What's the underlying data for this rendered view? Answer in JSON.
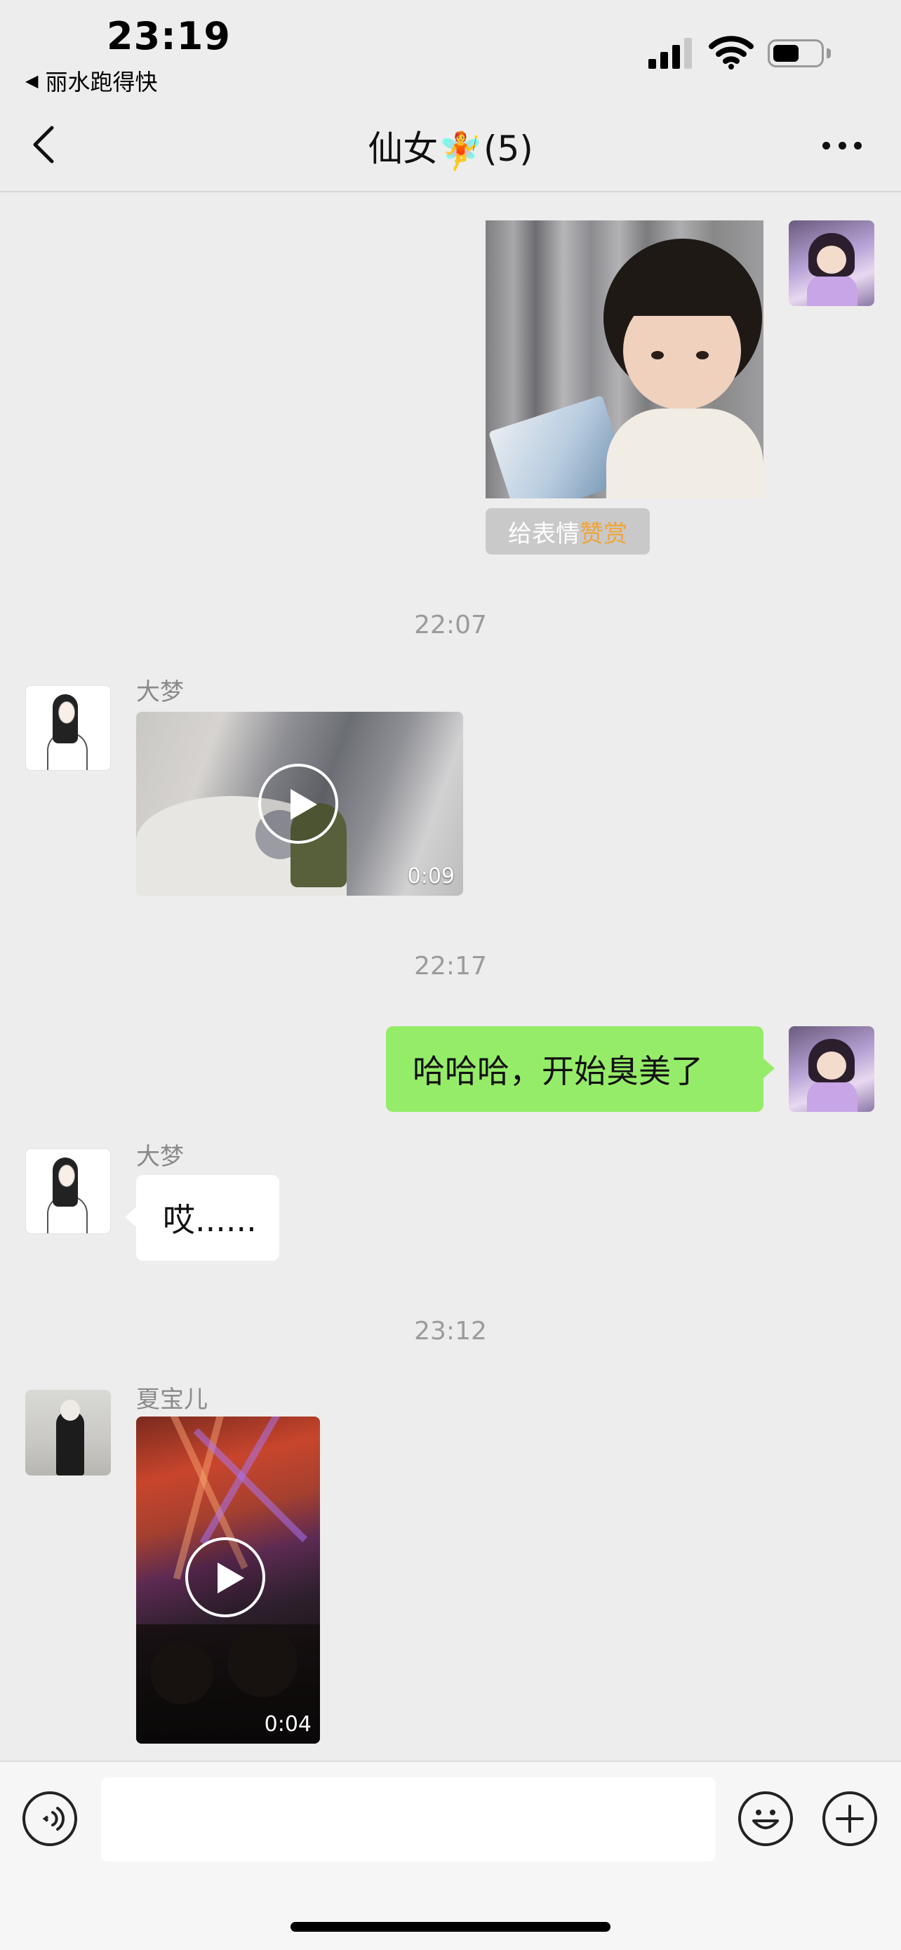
{
  "status_bar": {
    "time": "23:19",
    "back_app": "丽水跑得快",
    "back_app_icon": "left-triangle-icon"
  },
  "header": {
    "title": "仙女",
    "title_emoji": "🧚",
    "member_count": "(5)",
    "back_icon": "chevron-left-icon",
    "more_icon": "more-dots-icon"
  },
  "messages": [
    {
      "type": "sticker",
      "from": "me",
      "reward_prefix": "给表情",
      "reward_highlight": "赞赏"
    },
    {
      "type": "timestamp",
      "text": "22:07"
    },
    {
      "type": "video",
      "from": "大梦",
      "duration": "0:09"
    },
    {
      "type": "timestamp",
      "text": "22:17"
    },
    {
      "type": "text",
      "from": "me",
      "text": "哈哈哈，开始臭美了"
    },
    {
      "type": "text",
      "from": "大梦",
      "text": "哎......"
    },
    {
      "type": "timestamp",
      "text": "23:12"
    },
    {
      "type": "video",
      "from": "夏宝儿",
      "duration": "0:04"
    }
  ],
  "input_bar": {
    "voice_icon": "voice-icon",
    "emoji_icon": "emoji-icon",
    "plus_icon": "plus-icon",
    "input_value": ""
  },
  "colors": {
    "background": "#ededed",
    "my_bubble": "#95ec69",
    "reward_highlight": "#f0a53a"
  }
}
